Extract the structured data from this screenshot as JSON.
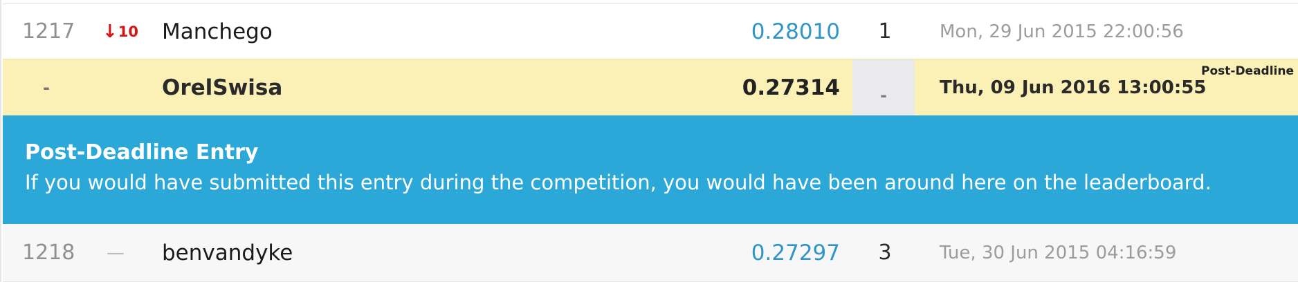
{
  "rows": {
    "top": {
      "rank": "1217",
      "change_arrow": "↓",
      "change_value": "10",
      "team": "Manchego",
      "score": "0.28010",
      "entries": "1",
      "last_submission": "Mon, 29 Jun 2015 22:00:56"
    },
    "user": {
      "rank": "-",
      "team": "OrelSwisa",
      "score": "0.27314",
      "entries": "-",
      "last_submission": "Thu, 09 Jun 2016 13:00:55",
      "flag": "Post-Deadline"
    },
    "bottom": {
      "rank": "1218",
      "change": "—",
      "team": "benvandyke",
      "score": "0.27297",
      "entries": "3",
      "last_submission": "Tue, 30 Jun 2015 04:16:59"
    }
  },
  "banner": {
    "title": "Post-Deadline Entry",
    "text": "If you would have submitted this entry during the competition, you would have been around here on the leaderboard."
  },
  "colors": {
    "highlight_row": "#fbf0b6",
    "banner": "#2ba7d8",
    "score_link": "#2f95c6",
    "rank_drop": "#d81313"
  }
}
